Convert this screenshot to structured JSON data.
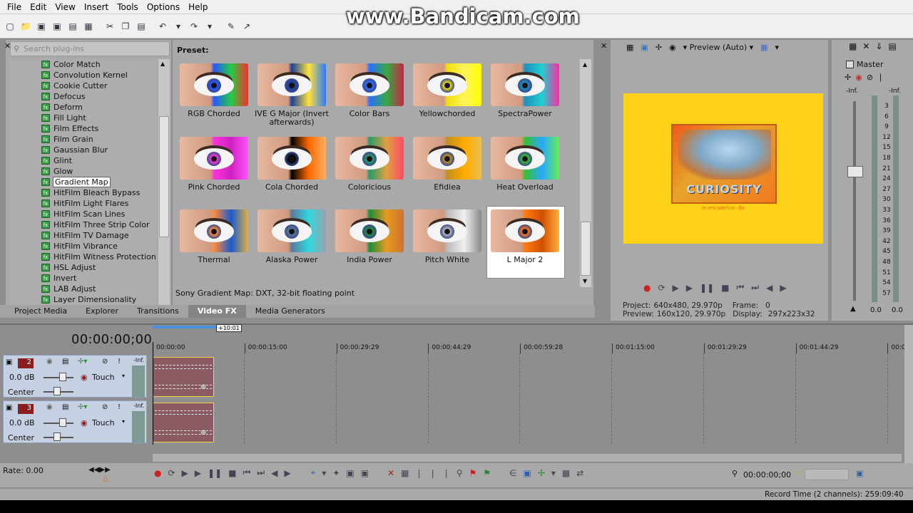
{
  "menu": [
    "File",
    "Edit",
    "View",
    "Insert",
    "Tools",
    "Options",
    "Help"
  ],
  "watermark": "www.Bandicam.com",
  "plugins": {
    "search_placeholder": "Search plug-ins",
    "items": [
      "Color Match",
      "Convolution Kernel",
      "Cookie Cutter",
      "Defocus",
      "Deform",
      "Fill Light",
      "Film Effects",
      "Film Grain",
      "Gaussian Blur",
      "Glint",
      "Glow",
      "Gradient Map",
      "HitFilm Bleach Bypass",
      "HitFilm Light Flares",
      "HitFilm Scan Lines",
      "HitFilm Three Strip Color",
      "HitFilm TV Damage",
      "HitFilm Vibrance",
      "HitFilm Witness Protection",
      "HSL Adjust",
      "Invert",
      "LAB Adjust",
      "Layer Dimensionality"
    ],
    "selected": "Gradient Map"
  },
  "presets": {
    "title": "Preset:",
    "items": [
      "RGB Chorded",
      "IVE G Major (Invert afterwards)",
      "Color Bars",
      "Yellowchorded",
      "SpectraPower",
      "Pink Chorded",
      "Cola Chorded",
      "Coloricious",
      "Efidiea",
      "Heat Overload",
      "Thermal",
      "Alaska Power",
      "India Power",
      "Pitch White",
      "L Major 2"
    ],
    "selected": "L Major 2",
    "description": "Sony Gradient Map: DXT, 32-bit floating point"
  },
  "tabs": [
    "Project Media",
    "Explorer",
    "Transitions",
    "Video FX",
    "Media Generators"
  ],
  "active_tab": "Video FX",
  "preview": {
    "mode": "Preview (Auto)",
    "frame_title": "CURIOSITY",
    "frame_subtitle": "le encadeños -ifa",
    "project_label": "Project:",
    "project_value": "640x480, 29.970p",
    "preview_label": "Preview:",
    "preview_value": "160x120, 29.970p",
    "frame_label": "Frame:",
    "frame_value": "0",
    "display_label": "Display:",
    "display_value": "297x223x32"
  },
  "master": {
    "label": "Master",
    "inf_left": "-Inf.",
    "inf_right": "-Inf.",
    "scale": [
      "3",
      "6",
      "9",
      "12",
      "15",
      "18",
      "21",
      "24",
      "27",
      "30",
      "33",
      "36",
      "39",
      "42",
      "45",
      "48",
      "51",
      "54",
      "57"
    ],
    "bottom_left": "0.0",
    "bottom_right": "0.0"
  },
  "timeline": {
    "timecode": "00:00:00;00",
    "length_badge": "+10:01",
    "ruler": [
      "00:00:00",
      "00:00:15:00",
      "00:00:29:29",
      "00:00:44:29",
      "00:00:59:28",
      "00:01:15:00",
      "00:01:29:29",
      "00:01:44:29",
      "00:0"
    ],
    "tracks": [
      {
        "num": "2",
        "volume": "0.0 dB",
        "pan": "Center",
        "mode": "Touch",
        "meter": "-Inf."
      },
      {
        "num": "3",
        "volume": "0.0 dB",
        "pan": "Center",
        "mode": "Touch",
        "meter": "-Inf."
      }
    ],
    "rate": "Rate: 0.00",
    "cursor_time": "00:00:00;00",
    "record_time": "Record Time (2 channels): 259:09:40"
  }
}
